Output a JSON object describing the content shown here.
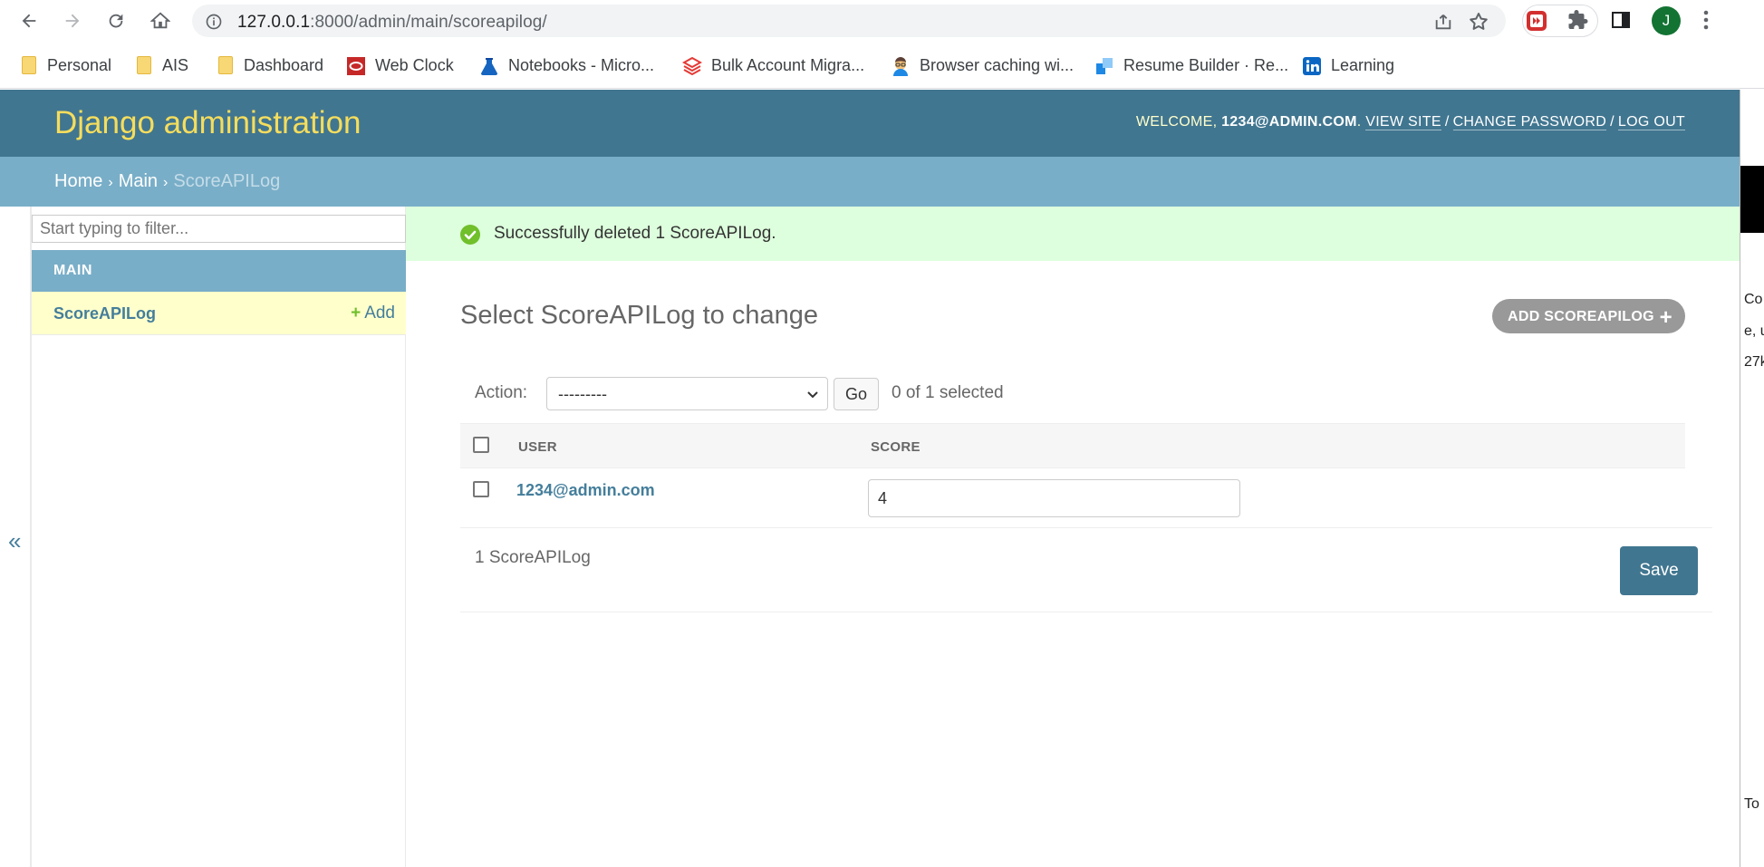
{
  "browser": {
    "url_host": "127.0.0.1",
    "url_rest": ":8000/admin/main/scoreapilog/",
    "avatar_letter": "J",
    "bookmarks": [
      {
        "label": "Personal",
        "icon": "folder-icon"
      },
      {
        "label": "AIS",
        "icon": "folder-icon"
      },
      {
        "label": "Dashboard",
        "icon": "folder-icon"
      },
      {
        "label": "Web Clock",
        "icon": "oracle-icon"
      },
      {
        "label": "Notebooks - Micro...",
        "icon": "flask-icon"
      },
      {
        "label": "Bulk Account Migra...",
        "icon": "databricks-icon"
      },
      {
        "label": "Browser caching wi...",
        "icon": "avatar-icon"
      },
      {
        "label": "Resume Builder · Re...",
        "icon": "resume-icon"
      },
      {
        "label": "Learning",
        "icon": "linkedin-icon"
      }
    ]
  },
  "header": {
    "branding": "Django administration",
    "welcome": "WELCOME, ",
    "user": "1234@ADMIN.COM",
    "view_site": "VIEW SITE",
    "change_password": "CHANGE PASSWORD",
    "log_out": "LOG OUT"
  },
  "breadcrumbs": {
    "home": "Home",
    "app": "Main",
    "current": "ScoreAPILog"
  },
  "sidebar": {
    "filter_placeholder": "Start typing to filter...",
    "module_caption": "MAIN",
    "model": "ScoreAPILog",
    "add_label": "Add",
    "toggle": "«"
  },
  "message": {
    "text": "Successfully deleted 1 ScoreAPILog."
  },
  "main": {
    "title": "Select ScoreAPILog to change",
    "add_button": "ADD SCOREAPILOG",
    "action_label": "Action:",
    "action_selected": "---------",
    "go_label": "Go",
    "selection_counter": "0 of 1 selected",
    "columns": [
      "USER",
      "SCORE"
    ],
    "rows": [
      {
        "user": "1234@admin.com",
        "score": "4"
      }
    ],
    "result_count": "1 ScoreAPILog",
    "save_label": "Save"
  },
  "right_window": {
    "fragments": [
      "Co",
      "e, u",
      "27k",
      "To"
    ]
  },
  "colors": {
    "header_bg": "#417690",
    "branding": "#f5dd5d",
    "breadcrumb_bg": "#79aec8",
    "link": "#447e9b",
    "success_bg": "#ddffdd",
    "success_icon": "#70bf2b",
    "selected_row": "#ffffcc"
  }
}
